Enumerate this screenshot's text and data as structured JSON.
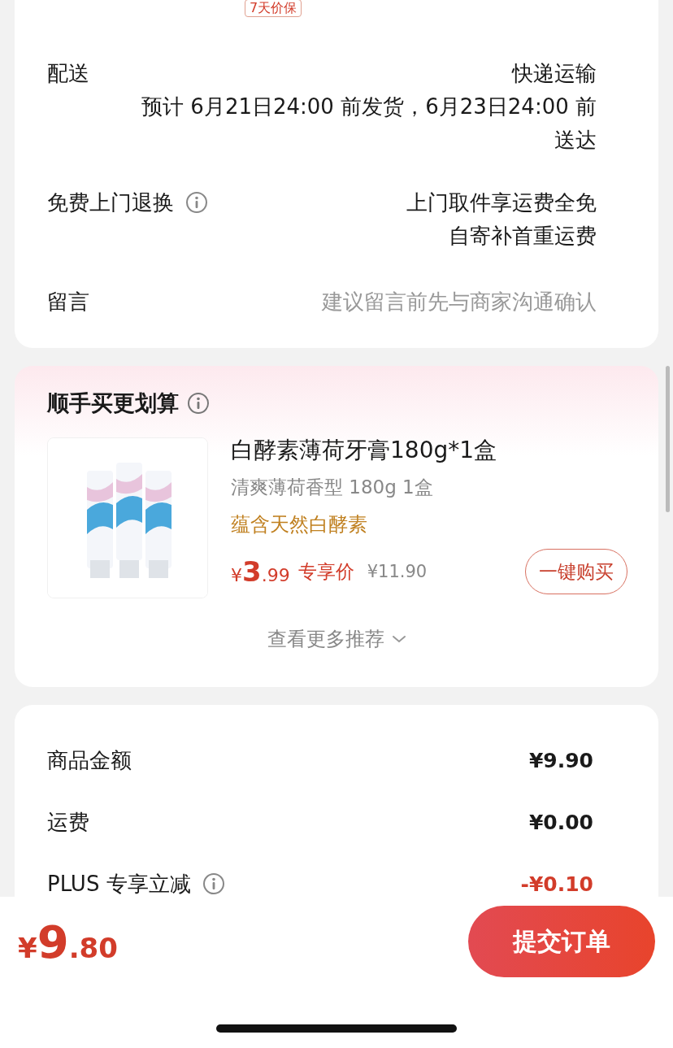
{
  "price_protect_badge": "7天价保",
  "delivery": {
    "label": "配送",
    "method": "快递运输",
    "estimate": "预计 6月21日24:00 前发货，6月23日24:00 前送达"
  },
  "return": {
    "label": "免费上门退换",
    "info": true,
    "lines": [
      "上门取件享运费全免",
      "自寄补首重运费"
    ]
  },
  "message": {
    "label": "留言",
    "placeholder": "建议留言前先与商家沟通确认"
  },
  "addon": {
    "title": "顺手买更划算",
    "info": true,
    "product": {
      "name": "白酵素薄荷牙膏180g*1盒",
      "spec": "清爽薄荷香型 180g 1盒",
      "tag": "蕴含天然白酵素",
      "price_symbol": "¥",
      "price_int": "3",
      "price_dec": ".99",
      "price_label": "专享价",
      "original_price": "¥11.90",
      "buy_button": "一键购买"
    },
    "more": "查看更多推荐"
  },
  "summary": [
    {
      "label": "商品金额",
      "value": "¥9.90",
      "info": false,
      "discount": false
    },
    {
      "label": "运费",
      "value": "¥0.00",
      "info": false,
      "discount": false
    },
    {
      "label": "PLUS 专享立减",
      "value": "-¥0.10",
      "info": true,
      "discount": true
    }
  ],
  "footer": {
    "symbol": "¥",
    "int": "9",
    "dec": ".80",
    "submit": "提交订单"
  }
}
